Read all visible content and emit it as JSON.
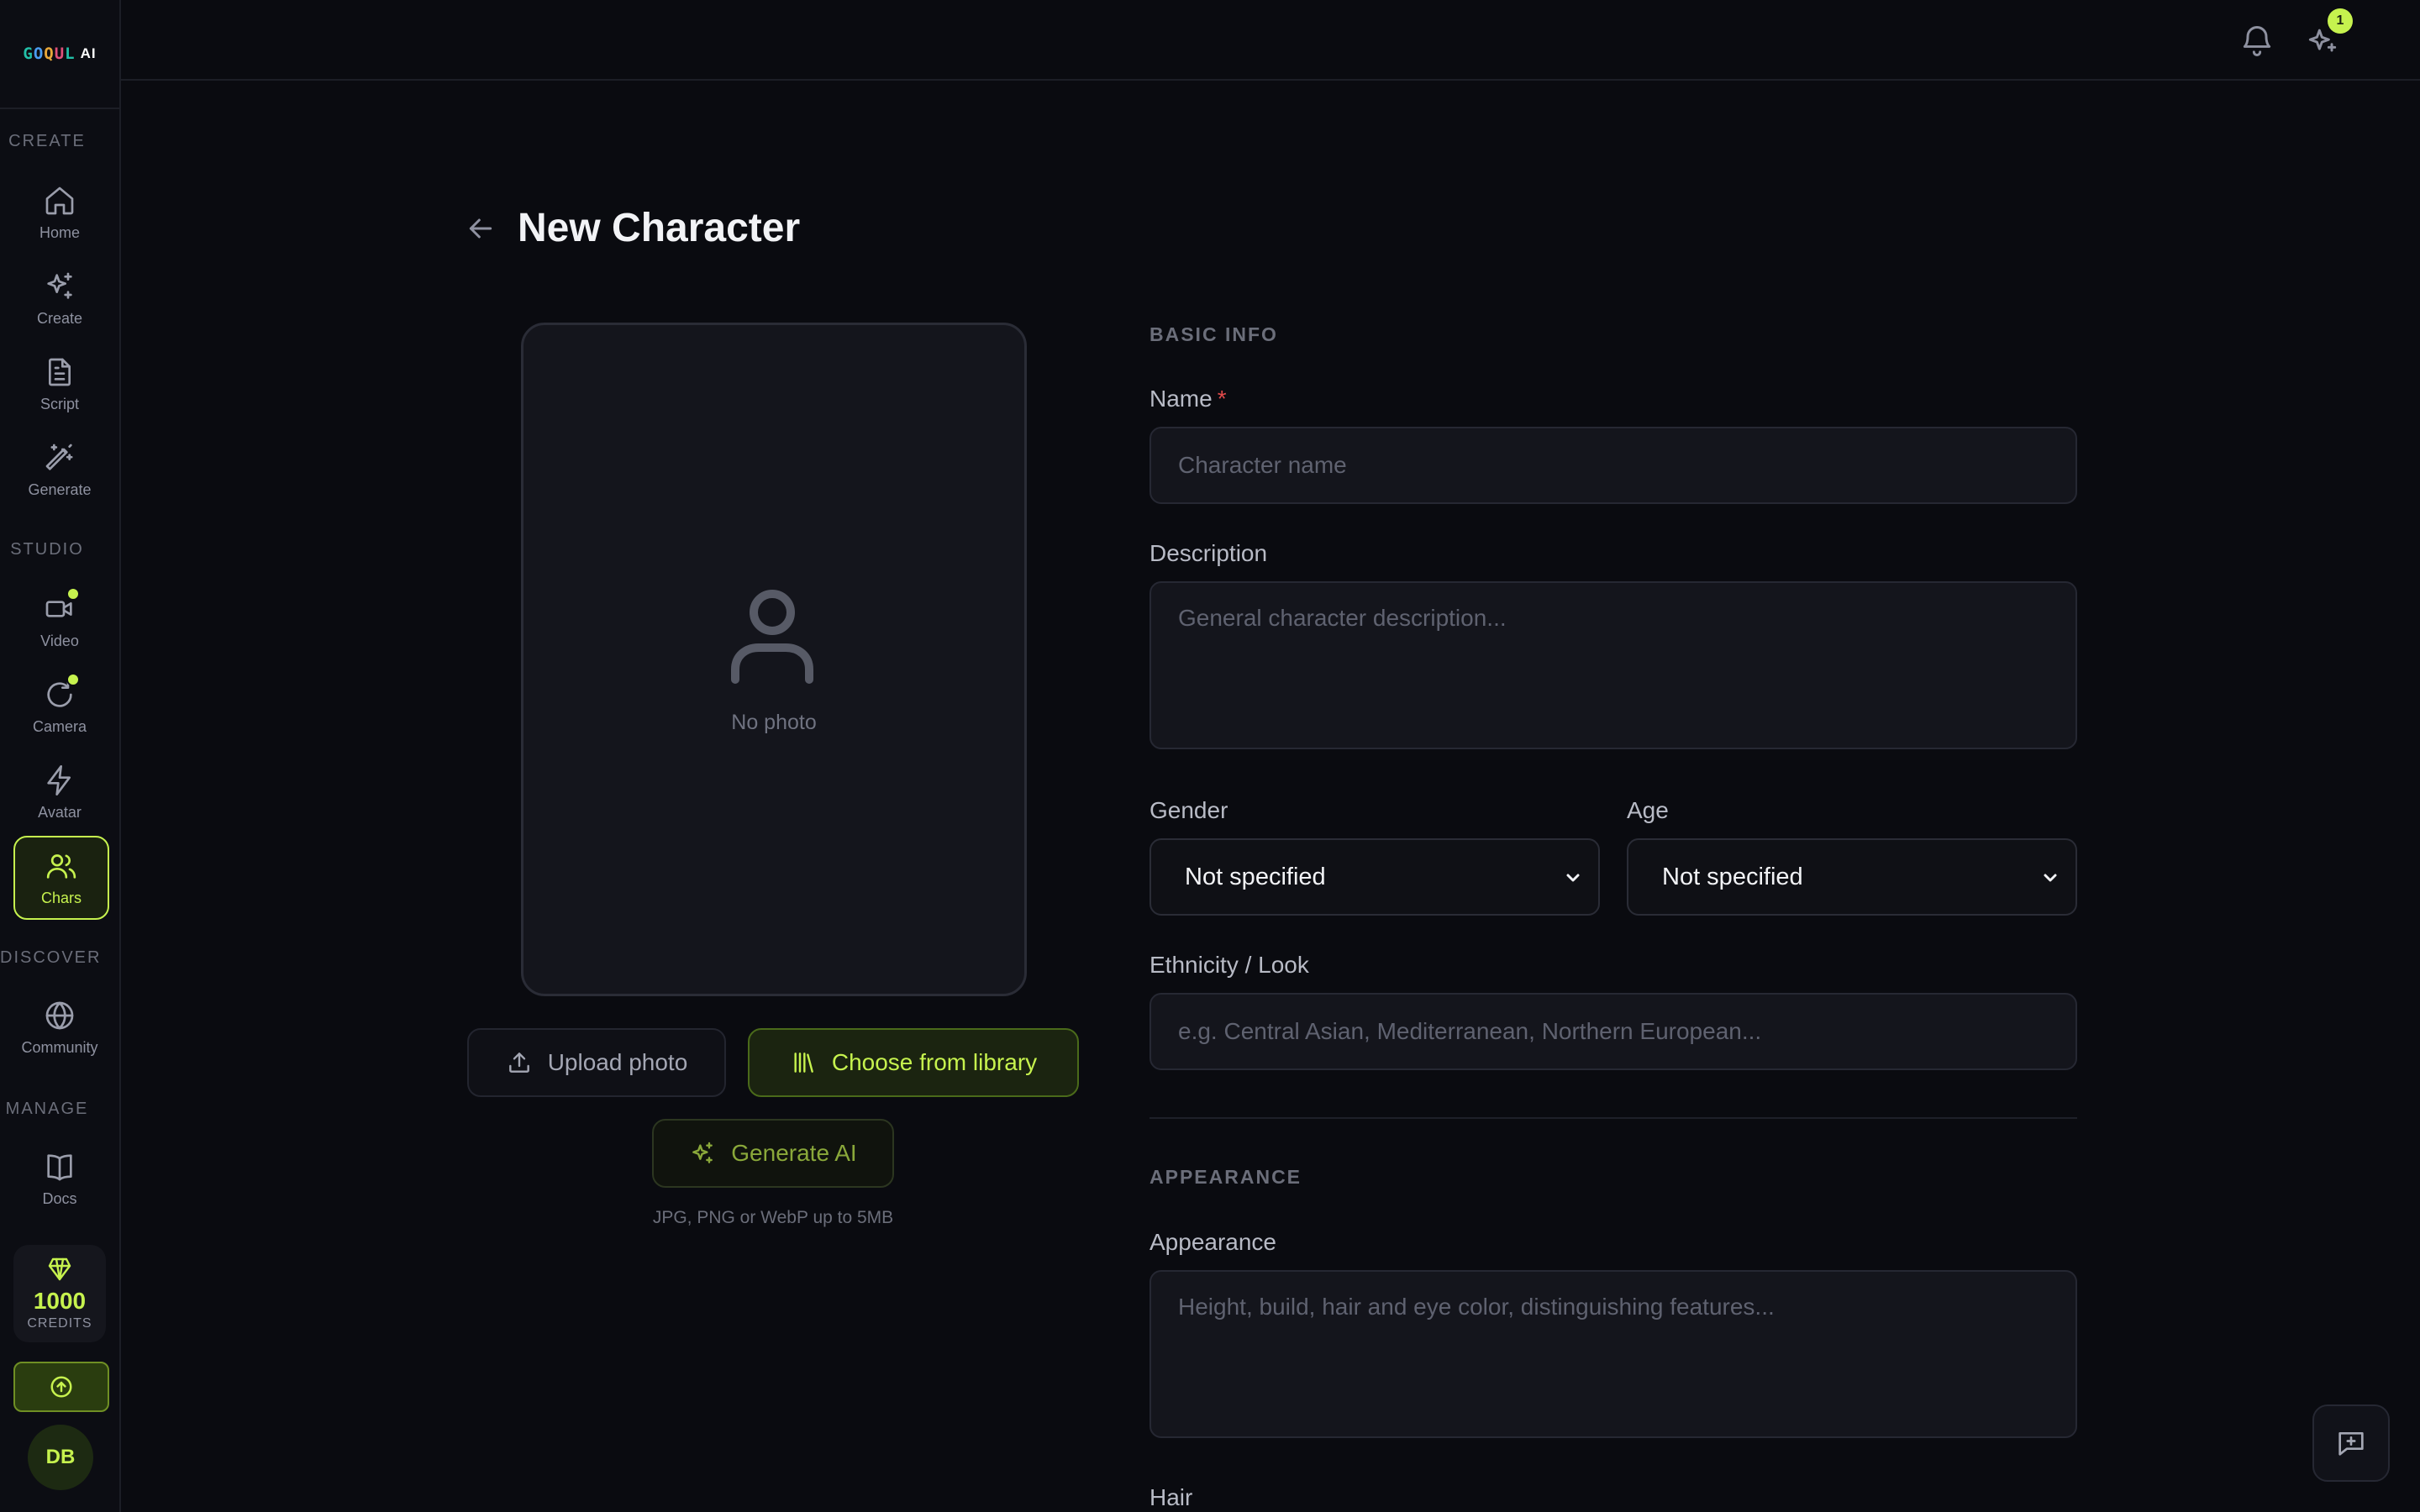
{
  "app": {
    "logo_letters": [
      "G",
      "O",
      "Q",
      "U",
      "L"
    ],
    "logo_suffix": "AI",
    "accent_color": "#c6f24e",
    "notification_badge": "1"
  },
  "sidebar": {
    "sections": [
      {
        "label": "CREATE"
      },
      {
        "label": "STUDIO"
      },
      {
        "label": "DISCOVER"
      },
      {
        "label": "MANAGE"
      }
    ],
    "items": [
      {
        "label": "Home",
        "icon": "home-icon"
      },
      {
        "label": "Create",
        "icon": "sparkle-icon"
      },
      {
        "label": "Script",
        "icon": "document-icon"
      },
      {
        "label": "Generate",
        "icon": "magic-wand-icon"
      },
      {
        "label": "Video",
        "icon": "video-camera-icon",
        "dot": true
      },
      {
        "label": "Camera",
        "icon": "rotate-icon",
        "dot": true
      },
      {
        "label": "Avatar",
        "icon": "lightning-icon"
      },
      {
        "label": "Chars",
        "icon": "users-icon",
        "active": true
      },
      {
        "label": "Community",
        "icon": "globe-icon"
      },
      {
        "label": "Docs",
        "icon": "book-icon"
      }
    ],
    "credits": {
      "value": "1000",
      "label": "CREDITS"
    },
    "user_initials": "DB"
  },
  "page": {
    "title": "New Character"
  },
  "photo": {
    "empty_text": "No photo",
    "upload_label": "Upload photo",
    "library_label": "Choose from library",
    "generate_label": "Generate AI",
    "hint": "JPG, PNG or WebP up to 5MB"
  },
  "form": {
    "basic_info_heading": "BASIC INFO",
    "name": {
      "label": "Name",
      "required_mark": "*",
      "placeholder": "Character name",
      "value": ""
    },
    "description": {
      "label": "Description",
      "placeholder": "General character description...",
      "value": ""
    },
    "gender": {
      "label": "Gender",
      "value": "Not specified"
    },
    "age": {
      "label": "Age",
      "value": "Not specified"
    },
    "ethnicity": {
      "label": "Ethnicity / Look",
      "placeholder": "e.g. Central Asian, Mediterranean, Northern European...",
      "value": ""
    },
    "appearance_heading": "APPEARANCE",
    "appearance": {
      "label": "Appearance",
      "placeholder": "Height, build, hair and eye color, distinguishing features...",
      "value": ""
    },
    "hair": {
      "label": "Hair"
    }
  }
}
